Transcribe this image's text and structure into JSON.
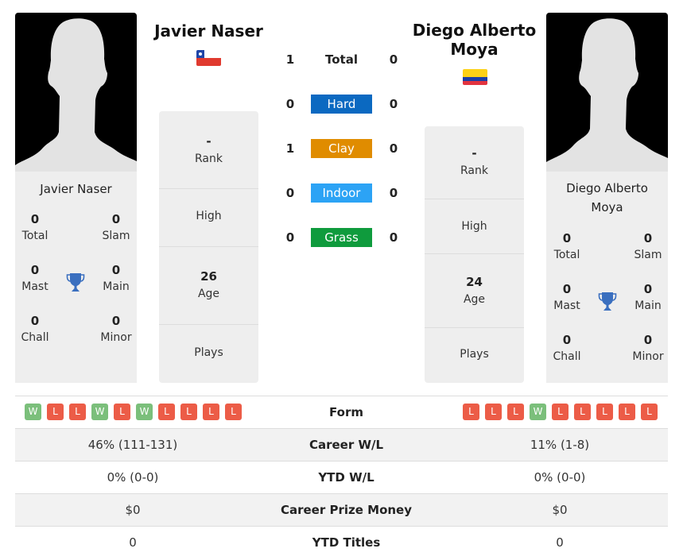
{
  "player1": {
    "name": "Javier Naser",
    "country_flag": "chile-flag",
    "titles": {
      "total": "0",
      "slam": "0",
      "mast": "0",
      "main": "0",
      "chall": "0",
      "minor": "0"
    },
    "titles_labels": {
      "total": "Total",
      "slam": "Slam",
      "mast": "Mast",
      "main": "Main",
      "chall": "Chall",
      "minor": "Minor"
    },
    "rank": "-",
    "rank_label": "Rank",
    "high_label": "High",
    "age": "26",
    "age_label": "Age",
    "plays_label": "Plays",
    "form": [
      "W",
      "L",
      "L",
      "W",
      "L",
      "W",
      "L",
      "L",
      "L",
      "L"
    ]
  },
  "player2": {
    "name": "Diego Alberto Moya",
    "country_flag": "colombia-flag",
    "titles": {
      "total": "0",
      "slam": "0",
      "mast": "0",
      "main": "0",
      "chall": "0",
      "minor": "0"
    },
    "titles_labels": {
      "total": "Total",
      "slam": "Slam",
      "mast": "Mast",
      "main": "Main",
      "chall": "Chall",
      "minor": "Minor"
    },
    "rank": "-",
    "rank_label": "Rank",
    "high_label": "High",
    "age": "24",
    "age_label": "Age",
    "plays_label": "Plays",
    "form": [
      "L",
      "L",
      "L",
      "W",
      "L",
      "L",
      "L",
      "L",
      "L"
    ]
  },
  "h2h": [
    {
      "label": "Total",
      "p1": "1",
      "p2": "0"
    },
    {
      "label": "Hard",
      "p1": "0",
      "p2": "0",
      "color": "#0b69c1"
    },
    {
      "label": "Clay",
      "p1": "1",
      "p2": "0",
      "color": "#e08c00"
    },
    {
      "label": "Indoor",
      "p1": "0",
      "p2": "0",
      "color": "#2ca3f5"
    },
    {
      "label": "Grass",
      "p1": "0",
      "p2": "0",
      "color": "#0f9b3d"
    }
  ],
  "comparison": [
    {
      "label": "Form"
    },
    {
      "label": "Career W/L",
      "p1": "46% (111-131)",
      "p2": "11% (1-8)"
    },
    {
      "label": "YTD W/L",
      "p1": "0% (0-0)",
      "p2": "0% (0-0)"
    },
    {
      "label": "Career Prize Money",
      "p1": "$0",
      "p2": "$0"
    },
    {
      "label": "YTD Titles",
      "p1": "0",
      "p2": "0"
    }
  ]
}
